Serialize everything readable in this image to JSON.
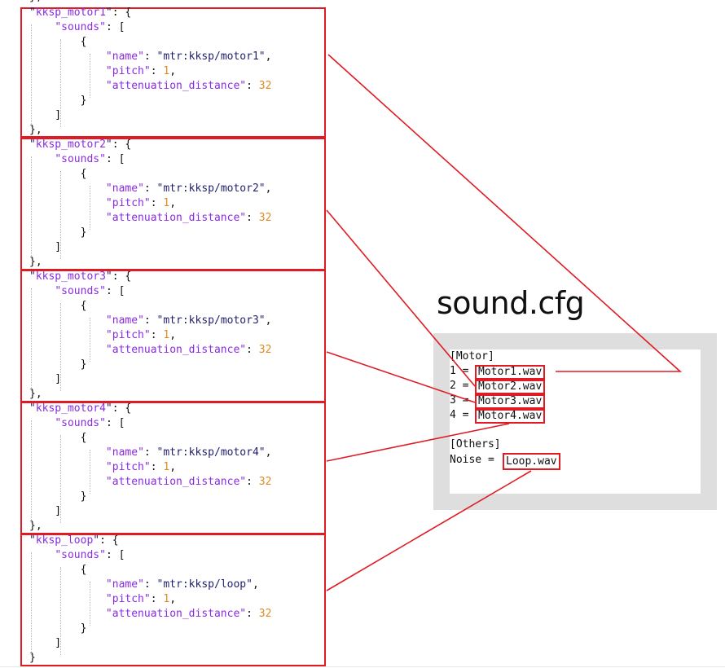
{
  "json_blocks": [
    {
      "key": "kksp_motor1",
      "sound_name": "mtr:kksp/motor1",
      "pitch": "1",
      "attenuation": "32",
      "closing": "},"
    },
    {
      "key": "kksp_motor2",
      "sound_name": "mtr:kksp/motor2",
      "pitch": "1",
      "attenuation": "32",
      "closing": "},"
    },
    {
      "key": "kksp_motor3",
      "sound_name": "mtr:kksp/motor3",
      "pitch": "1",
      "attenuation": "32",
      "closing": "},"
    },
    {
      "key": "kksp_motor4",
      "sound_name": "mtr:kksp/motor4",
      "pitch": "1",
      "attenuation": "32",
      "closing": "},"
    },
    {
      "key": "kksp_loop",
      "sound_name": "mtr:kksp/loop",
      "pitch": "1",
      "attenuation": "32",
      "closing": "}"
    }
  ],
  "json_labels": {
    "sounds": "sounds",
    "name": "name",
    "pitch": "pitch",
    "attenuation_distance": "attenuation_distance",
    "top_fragment": "},"
  },
  "cfg": {
    "title": "sound.cfg",
    "motor_section": "[Motor]",
    "motor_entries": [
      {
        "key": "1 =",
        "file": "Motor1.wav"
      },
      {
        "key": "2 =",
        "file": "Motor2.wav"
      },
      {
        "key": "3 =",
        "file": "Motor3.wav"
      },
      {
        "key": "4 =",
        "file": "Motor4.wav"
      }
    ],
    "others_section": "[Others]",
    "noise_key": "Noise =",
    "noise_file": "Loop.wav"
  },
  "colors": {
    "highlight": "#e01b24",
    "key": "#8a2be2",
    "number": "#e08a1e",
    "string": "#1f1f6e",
    "frame": "#dedede"
  }
}
